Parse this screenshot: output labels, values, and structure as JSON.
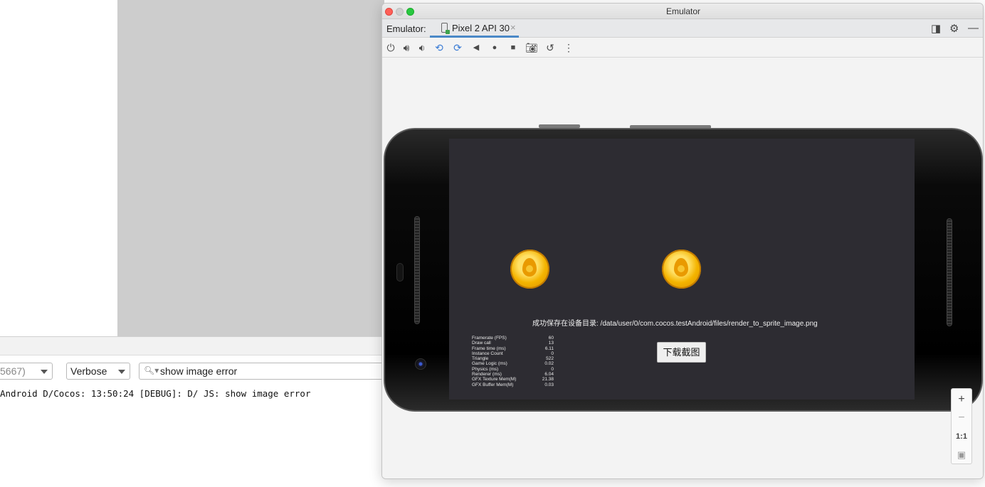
{
  "logcat": {
    "process_fragment": "5667)",
    "level": "Verbose",
    "search_value": "show image error",
    "log_line": "Android D/Cocos: 13:50:24 [DEBUG]: D/ JS: show image error"
  },
  "emulator": {
    "window_title": "Emulator",
    "label": "Emulator:",
    "device_tab": "Pixel 2 API 30",
    "tab_close": "×",
    "toolbar_icons": [
      "power-icon",
      "volume-up-icon",
      "volume-down-icon",
      "rotate-left-icon",
      "rotate-right-icon",
      "back-icon",
      "home-icon",
      "overview-icon",
      "camera-icon",
      "snapshot-icon",
      "more-icon"
    ]
  },
  "game": {
    "save_message": "成功保存在设备目录: /data/user/0/com.cocos.testAndroid/files/render_to_sprite_image.png",
    "download_button": "下载截图",
    "stats": [
      {
        "label": "Framerate (FPS)",
        "value": "60"
      },
      {
        "label": "Draw call",
        "value": "13"
      },
      {
        "label": "Frame time (ms)",
        "value": "6.11"
      },
      {
        "label": "Instance Count",
        "value": "0"
      },
      {
        "label": "Triangle",
        "value": "522"
      },
      {
        "label": "Game Logic (ms)",
        "value": "0.02"
      },
      {
        "label": "Physics (ms)",
        "value": "0"
      },
      {
        "label": "Renderer (ms)",
        "value": "6.04"
      },
      {
        "label": "GFX Texture Mem(M)",
        "value": "21.38"
      },
      {
        "label": "GFX Buffer Mem(M)",
        "value": "0.03"
      }
    ]
  },
  "zoom": {
    "zoom_in": "+",
    "zoom_out": "−",
    "actual_size": "1:1"
  }
}
